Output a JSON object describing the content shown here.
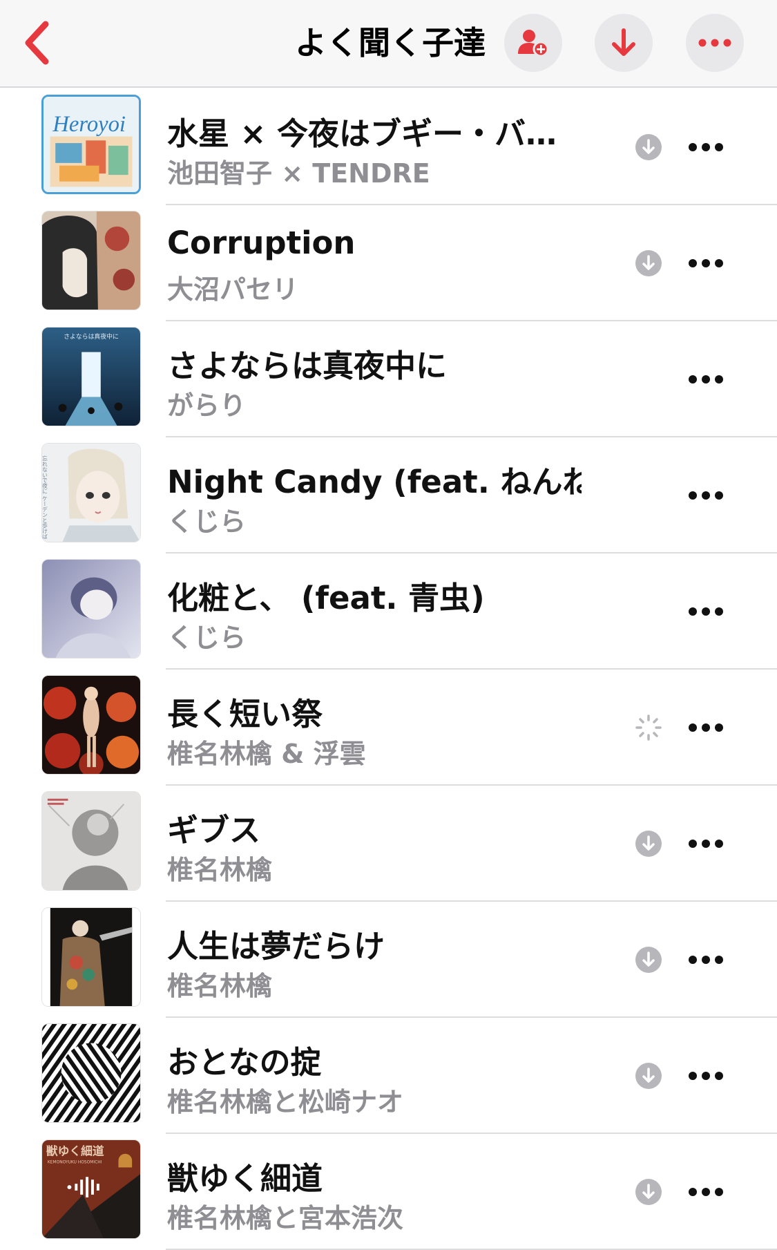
{
  "header": {
    "title": "よく聞く子達",
    "icons": {
      "back": "chevron-left-icon",
      "add_person": "person-add-icon",
      "download": "arrow-down-icon",
      "more": "ellipsis-icon"
    }
  },
  "colors": {
    "accent": "#e5393f",
    "secondary_text": "#8e8e93",
    "download_icon": "#b6b6bb",
    "header_button_bg": "#e8e8ea"
  },
  "songs": [
    {
      "title": "水星 × 今夜はブギー・バ…",
      "artist": "池田智子 × TENDRE",
      "status": "download"
    },
    {
      "title": "Corruption",
      "artist": "大沼パセリ",
      "status": "download"
    },
    {
      "title": "さよならは真夜中に",
      "artist": "がらり",
      "status": "none"
    },
    {
      "title": "Night Candy (feat. ねんね)",
      "artist": "くじら",
      "status": "none"
    },
    {
      "title": "化粧と、 (feat. 青虫)",
      "artist": "くじら",
      "status": "none"
    },
    {
      "title": "長く短い祭",
      "artist": "椎名林檎 & 浮雲",
      "status": "pending"
    },
    {
      "title": "ギブス",
      "artist": "椎名林檎",
      "status": "download"
    },
    {
      "title": "人生は夢だらけ",
      "artist": "椎名林檎",
      "status": "download"
    },
    {
      "title": "おとなの掟",
      "artist": "椎名林檎と松崎ナオ",
      "status": "download"
    },
    {
      "title": "獣ゆく細道",
      "artist": "椎名林檎と宮本浩次",
      "status": "download"
    }
  ],
  "artwork_texts": {
    "song1": "Heroyoi",
    "song3": "さよならは真夜中に",
    "song4": "忘れないで夜に ケーデンと歩けば",
    "song10_title": "獣ゆく細道",
    "song10_sub": "KEMONOYUKU HOSOMICHI"
  }
}
